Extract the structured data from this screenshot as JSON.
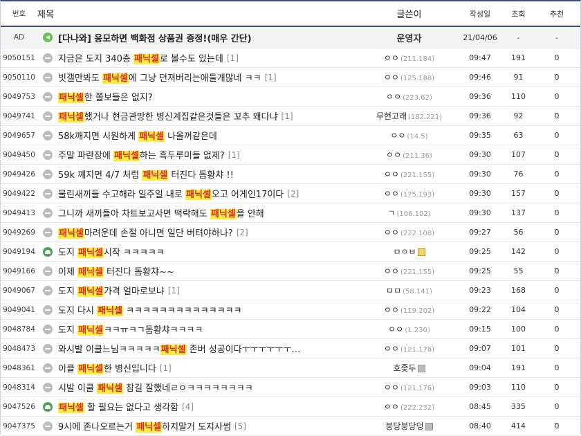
{
  "headers": {
    "num": "번호",
    "title": "제목",
    "writer": "글쓴이",
    "date": "작성일",
    "views": "조회",
    "recommend": "추천"
  },
  "notice": {
    "num": "AD",
    "title": "[다나와] 응모하면 백화점 상품권 증정!(매우 간단)",
    "writer": "운영자",
    "date": "21/04/06",
    "views": "-",
    "recommend": "-",
    "icon": "speaker-icon"
  },
  "rows": [
    {
      "num": "9050151",
      "icon": "chat-icon",
      "pre": "지금은 도지 340층 ",
      "hl": "패닉셀",
      "post": "로 볼수도 있는데",
      "comments": "[1]",
      "writer": "ㅇㅇ",
      "ip": "(211.184)",
      "badge": "",
      "date": "09:47",
      "views": "191",
      "rec": "0"
    },
    {
      "num": "9050110",
      "icon": "chat-icon",
      "pre": "빗갤만봐도 ",
      "hl": "패닉셀",
      "post": "에 그냥 던져버리는애들개많네 ㅋㅋ",
      "comments": "[1]",
      "writer": "ㅇㅇ",
      "ip": "(125.188)",
      "badge": "",
      "date": "09:46",
      "views": "91",
      "rec": "0"
    },
    {
      "num": "9049753",
      "icon": "chat-icon",
      "pre": "",
      "hl": "패닉셀",
      "post": "한 쫄보들은 없지?",
      "comments": "",
      "writer": "ㅇㅇ",
      "ip": "(223.62)",
      "badge": "",
      "date": "09:36",
      "views": "110",
      "rec": "0"
    },
    {
      "num": "9049741",
      "icon": "chat-icon",
      "pre": "",
      "hl": "패닉셀",
      "post": "했거나 현금관망한 병신계집같은것들은 꼬추 왜다냐",
      "comments": "[1]",
      "writer": "무현고래",
      "ip": "(182.221)",
      "badge": "",
      "date": "09:36",
      "views": "92",
      "rec": "0"
    },
    {
      "num": "9049657",
      "icon": "chat-icon",
      "pre": "58k깨지면 시원하게 ",
      "hl": "패닉셀",
      "post": " 나올꺼같은데",
      "comments": "",
      "writer": "ㅇㅇ",
      "ip": "(14.5)",
      "badge": "",
      "date": "09:35",
      "views": "63",
      "rec": "0"
    },
    {
      "num": "9049450",
      "icon": "chat-icon",
      "pre": "주말 파란장에 ",
      "hl": "패닉셀",
      "post": "하는 흑두루미들 없제?",
      "comments": "[1]",
      "writer": "ㅇㅇ",
      "ip": "(211.36)",
      "badge": "",
      "date": "09:30",
      "views": "107",
      "rec": "0"
    },
    {
      "num": "9049426",
      "icon": "chat-icon",
      "pre": "59k 깨지면 4/7 처럼 ",
      "hl": "패닉셀",
      "post": " 터진다 돔황챠 !!",
      "comments": "",
      "writer": "ㅇㅇ",
      "ip": "(221.155)",
      "badge": "",
      "date": "09:30",
      "views": "76",
      "rec": "0"
    },
    {
      "num": "9049422",
      "icon": "chat-icon",
      "pre": "물린새끼들 수고해라 일주일 내로 ",
      "hl": "패닉셀",
      "post": "오고 어게인17이다",
      "comments": "[2]",
      "writer": "ㅇㅇ",
      "ip": "(175.193)",
      "badge": "",
      "date": "09:30",
      "views": "157",
      "rec": "0"
    },
    {
      "num": "9049413",
      "icon": "chat-icon",
      "pre": "그니까 새끼들아 차트보고사면 떡락해도 ",
      "hl": "패닉셀",
      "post": "을 안해",
      "comments": "",
      "writer": "ㄱ",
      "ip": "(106.102)",
      "badge": "",
      "date": "09:30",
      "views": "137",
      "rec": "0"
    },
    {
      "num": "9049269",
      "icon": "chat-icon",
      "pre": "",
      "hl": "패닉셀",
      "post": "마려운데 손절 아니면 일단 버텨야하나?",
      "comments": "[2]",
      "writer": "ㅇㅇ",
      "ip": "(222.108)",
      "badge": "",
      "date": "09:27",
      "views": "56",
      "rec": "0"
    },
    {
      "num": "9049194",
      "icon": "image-icon",
      "pre": "도지 ",
      "hl": "패닉셀",
      "post": "시작 ㅋㅋㅋㅋㅋ",
      "comments": "",
      "writer": "ㅁㅇㅂ",
      "ip": "",
      "badge": "gold",
      "date": "09:25",
      "views": "142",
      "rec": "0"
    },
    {
      "num": "9049166",
      "icon": "chat-icon",
      "pre": "이제 ",
      "hl": "패닉셀",
      "post": " 터진다 돔황챠~~",
      "comments": "",
      "writer": "ㅇㅇ",
      "ip": "(221.155)",
      "badge": "",
      "date": "09:25",
      "views": "55",
      "rec": "0"
    },
    {
      "num": "9049067",
      "icon": "chat-icon",
      "pre": "도지 ",
      "hl": "패닉셀",
      "post": "가격 얼마로보냐",
      "comments": "[1]",
      "writer": "ㅁㅁ",
      "ip": "(58.141)",
      "badge": "",
      "date": "09:23",
      "views": "168",
      "rec": "0"
    },
    {
      "num": "9049041",
      "icon": "chat-icon",
      "pre": "도지 다시 ",
      "hl": "패닉셀",
      "post": " ㅋㅋㅋㅋㅋㅋㅋㅋㅋㅋㅋㅋㅋㅋ",
      "comments": "",
      "writer": "ㅇㅇ",
      "ip": "(119.202)",
      "badge": "",
      "date": "09:22",
      "views": "104",
      "rec": "0"
    },
    {
      "num": "9048784",
      "icon": "chat-icon",
      "pre": "도지 ",
      "hl": "패닉셀",
      "post": "ㅋㅋㅠㅋㄱ돔황챠ㅋㅋㅋㅋ",
      "comments": "",
      "writer": "ㅇㅇ",
      "ip": "(1.230)",
      "badge": "",
      "date": "09:15",
      "views": "100",
      "rec": "0"
    },
    {
      "num": "9048473",
      "icon": "chat-icon",
      "pre": "와시발 이클느님ㅋㅋㅋㅋㅋ",
      "hl": "패닉셀",
      "post": " 존버 성공이다ㅜㅜㅜㅜㅜㅜ…",
      "comments": "",
      "writer": "ㅇㅇ",
      "ip": "(121.176)",
      "badge": "",
      "date": "09:07",
      "views": "101",
      "rec": "0"
    },
    {
      "num": "9048361",
      "icon": "chat-icon",
      "pre": "이클 ",
      "hl": "패닉셀",
      "post": "한 병신입니다",
      "comments": "[1]",
      "writer": "호좆두",
      "ip": "",
      "badge": "gray",
      "date": "09:04",
      "views": "191",
      "rec": "0"
    },
    {
      "num": "9048314",
      "icon": "chat-icon",
      "pre": "시발 이클 ",
      "hl": "패닉셀",
      "post": " 참길 잘했네ㄹㅇㅋㅋㅋㅋㅋㅋㅋㅋ",
      "comments": "",
      "writer": "ㅇㅇ",
      "ip": "(121.176)",
      "badge": "",
      "date": "09:03",
      "views": "110",
      "rec": "0"
    },
    {
      "num": "9047526",
      "icon": "image-icon",
      "pre": "",
      "hl": "패닉셀",
      "post": " 할 필요는 없다고 생각함",
      "comments": "[4]",
      "writer": "ㅇㅇ",
      "ip": "(222.232)",
      "badge": "",
      "date": "08:45",
      "views": "335",
      "rec": "0"
    },
    {
      "num": "9047375",
      "icon": "chat-icon",
      "pre": "9시에 존나오르는거 ",
      "hl": "패닉셀",
      "post": "하지말거 도지사썸",
      "comments": "[5]",
      "writer": "붕당붕당덩",
      "ip": "",
      "badge": "gray",
      "date": "08:40",
      "views": "414",
      "rec": "0"
    }
  ]
}
